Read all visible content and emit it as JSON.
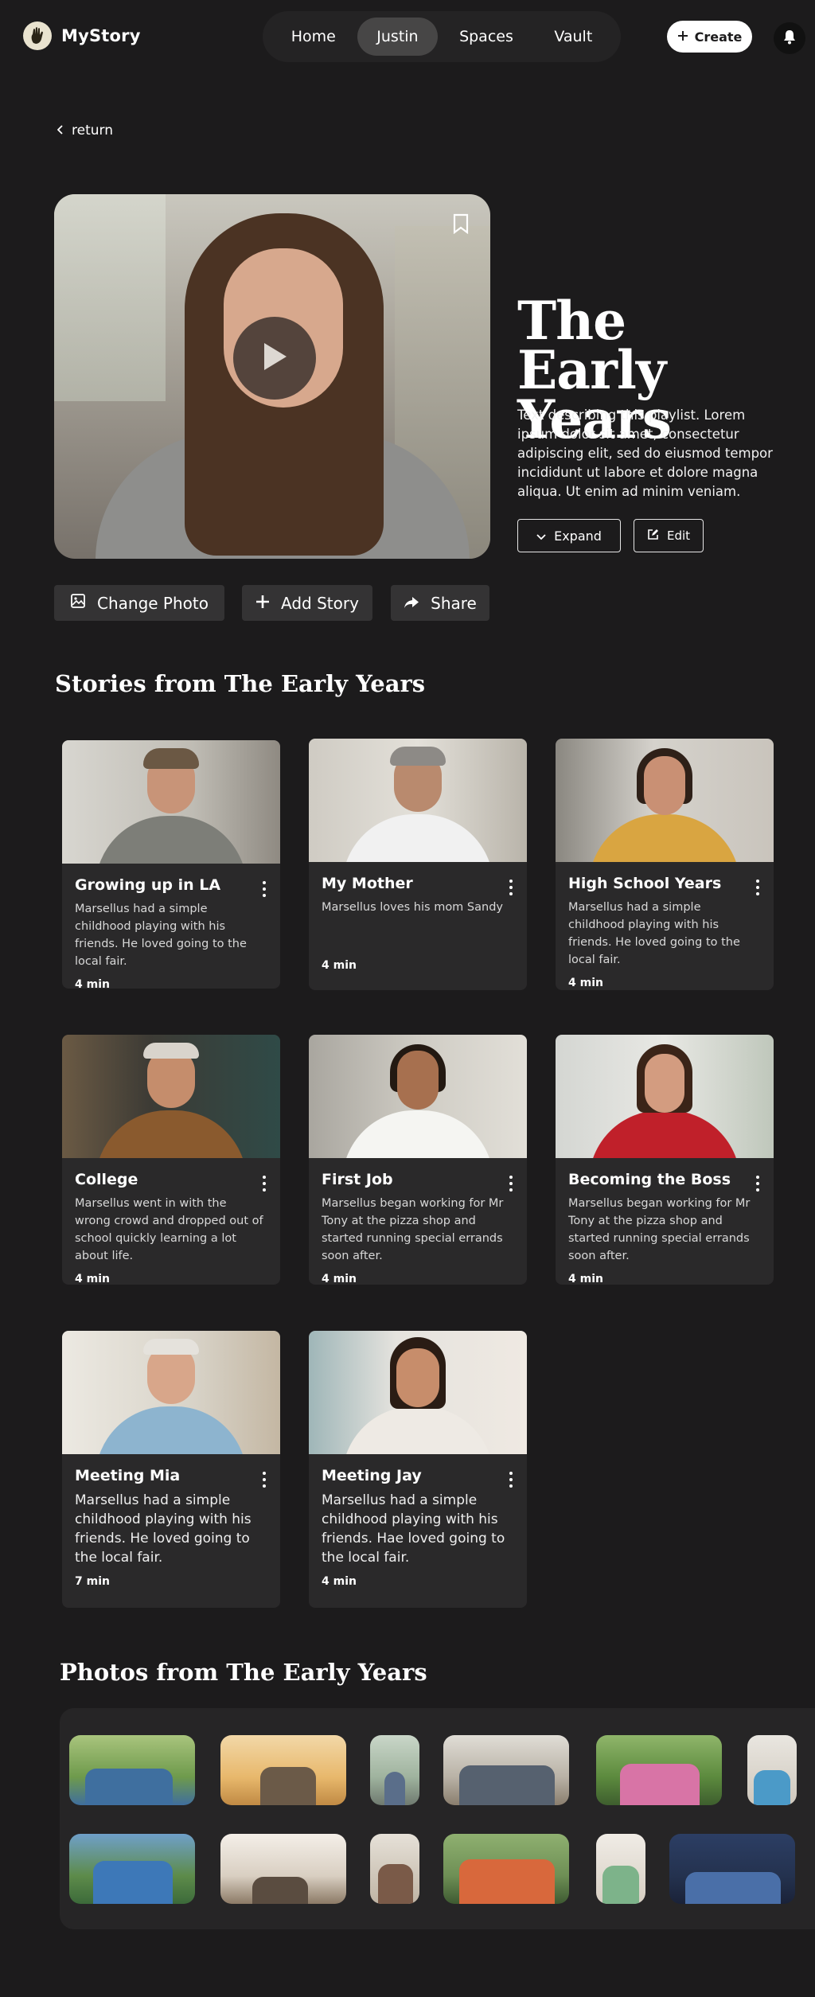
{
  "app": {
    "name": "MyStory"
  },
  "nav": {
    "tabs": [
      {
        "label": "Home",
        "active": false
      },
      {
        "label": "Justin",
        "active": true
      },
      {
        "label": "Spaces",
        "active": false
      },
      {
        "label": "Vault",
        "active": false
      }
    ],
    "create_label": "Create"
  },
  "return_label": "return",
  "playlist": {
    "title": "The Early Years",
    "description": "Text describing this playlist. Lorem ipsum dolor sit amet, consectetur adipiscing elit, sed do eiusmod tempor incididunt ut labore et dolore magna aliqua. Ut enim ad minim veniam.",
    "expand_label": "Expand",
    "edit_label": "Edit"
  },
  "actions": {
    "change_photo": "Change Photo",
    "add_story": "Add Story",
    "share": "Share"
  },
  "stories_section_title": "Stories from The Early Years",
  "stories": [
    {
      "title": "Growing up in LA",
      "description": "Marsellus had a simple childhood playing with his friends. He loved going to the local fair.",
      "duration": "4 min"
    },
    {
      "title": "My Mother",
      "description": "Marsellus loves his mom Sandy",
      "duration": "4 min"
    },
    {
      "title": "High School Years",
      "description": "Marsellus had a simple childhood playing with his friends. He loved going to the local fair.",
      "duration": "4 min"
    },
    {
      "title": "College",
      "description": "Marsellus went in with the wrong crowd and dropped out of school quickly learning a lot about life.",
      "duration": "4 min"
    },
    {
      "title": "First Job",
      "description": "Marsellus began working for Mr Tony at the pizza shop and started running special errands soon after.",
      "duration": "4 min"
    },
    {
      "title": "Becoming the Boss",
      "description": "Marsellus began working for Mr Tony at the pizza shop and started running special errands soon after.",
      "duration": "4 min"
    },
    {
      "title": "Meeting Mia",
      "description": "Marsellus had a simple childhood playing with his friends. He loved going to the local fair.",
      "duration": "7 min"
    },
    {
      "title": "Meeting Jay",
      "description": "Marsellus had a simple childhood playing with his friends. Hae loved going to the local fair.",
      "duration": "4 min"
    }
  ],
  "photos_section_title": "Photos from The Early Years",
  "icons": {
    "logo": "hand-logo-icon",
    "bell": "bell-icon",
    "bookmark": "bookmark-icon",
    "play": "play-icon",
    "return": "chevron-left-icon",
    "expand": "chevron-down-icon",
    "edit": "edit-icon",
    "change_photo": "image-icon",
    "add_story": "plus-icon",
    "share": "share-icon",
    "card_menu": "kebab-menu-icon"
  }
}
